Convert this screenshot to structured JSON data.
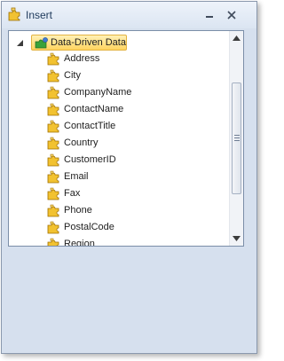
{
  "window": {
    "title": "Insert"
  },
  "tree": {
    "root_label": "Data-Driven Data",
    "items": [
      "Address",
      "City",
      "CompanyName",
      "ContactName",
      "ContactTitle",
      "Country",
      "CustomerID",
      "Email",
      "Fax",
      "Phone",
      "PostalCode",
      "Region"
    ]
  },
  "icons": {
    "title": "insert-puzzle-icon",
    "root": "data-source-icon",
    "field": "field-puzzle-icon"
  },
  "colors": {
    "accent": "#1e395b",
    "selection_fill": "#ffd45f",
    "panel_background": "#d6e0ee"
  }
}
